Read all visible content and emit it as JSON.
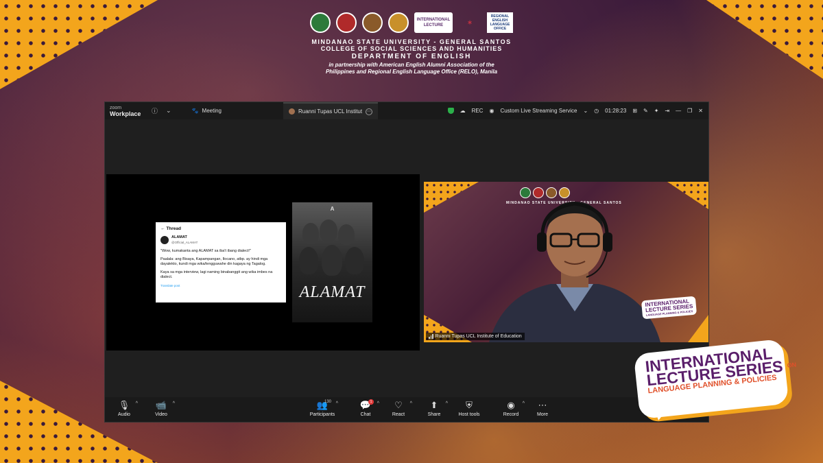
{
  "header": {
    "line1": "MINDANAO STATE UNIVERSITY - GENERAL SANTOS",
    "line2": "COLLEGE OF SOCIAL SCIENCES AND HUMANITIES",
    "line3": "DEPARTMENT OF ENGLISH",
    "line4a": "in partnership with American English Alumni Association of the",
    "line4b": "Philippines and Regional English Language Office (RELO), Manila",
    "badge_text": "INTERNATIONAL LECTURE",
    "relo_text": "REGIONAL ENGLISH LANGUAGE OFFICE"
  },
  "zoom": {
    "brand_small": "zoom",
    "brand_main": "Workplace",
    "meeting_tab": "Meeting",
    "active_tab": "Ruanni Tupas UCL Institute of Education",
    "rec_label": "REC",
    "streaming_label": "Custom Live Streaming Service",
    "timer": "01:28:23"
  },
  "tweet": {
    "header": "Thread",
    "name": "ALAMAT",
    "handle": "@Official_ALAMAT",
    "p1": "\"Wow, kumakanta ang ALAMAT sa iba't ibang dialect!\"",
    "p2": "Paalala: ang Bisaya, Kapampangan, Ilocano, atbp. ay hindi mga dayalekto, kundi mga wika/lengguwahe din kagaya ng Tagalog.",
    "p3": "Kaya sa mga interview, lagi naming binabanggit ang wika imbes na dialect.",
    "link": "Translate post"
  },
  "album": {
    "title": "ALAMAT",
    "logo": "A"
  },
  "video": {
    "speaker_label": "Ruanni Tupas UCL Institute of Education",
    "bg_header": "MINDANAO STATE UNIVERSITY - GENERAL SANTOS",
    "ils_l1": "INTERNATIONAL",
    "ils_l2": "LECTURE SERIES",
    "ils_l3": "LANGUAGE PLANNING & POLICIES"
  },
  "controls": {
    "audio": "Audio",
    "video": "Video",
    "participants": "Participants",
    "participant_count": "130",
    "chat": "Chat",
    "chat_badge": "1",
    "react": "React",
    "share": "Share",
    "host_tools": "Host tools",
    "record": "Record",
    "more": "More"
  },
  "series": {
    "line1": "INTERNATIONAL",
    "line2": "LECTURE SERIES",
    "on": "ON",
    "line3": "LANGUAGE PLANNING & POLICIES"
  },
  "colors": {
    "accent_orange": "#f3a51c",
    "brand_purple": "#5a1e6a",
    "record_red": "#e03a3a"
  }
}
